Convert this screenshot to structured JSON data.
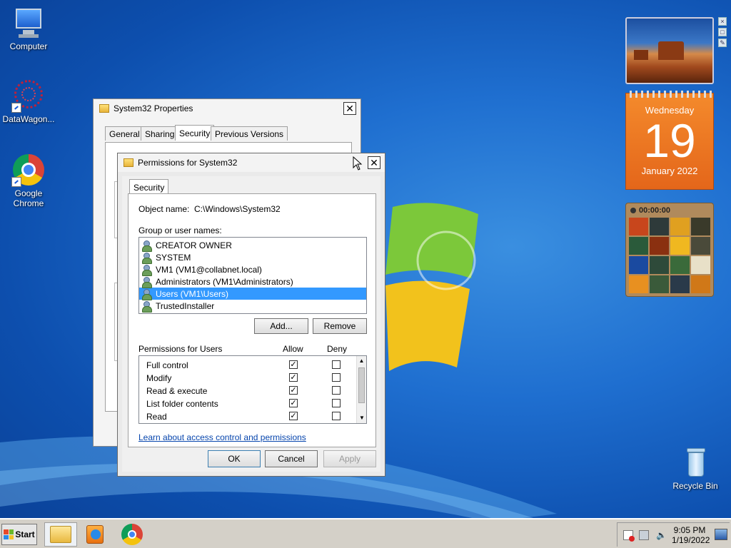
{
  "desktop": {
    "icons": [
      {
        "label": "Computer"
      },
      {
        "label": "DataWagon..."
      },
      {
        "label": "Google Chrome"
      },
      {
        "label": "Recycle Bin"
      }
    ]
  },
  "gadgets": {
    "calendar": {
      "weekday": "Wednesday",
      "day": "19",
      "month_year": "January 2022"
    },
    "puzzle": {
      "timer": "00:00:00"
    }
  },
  "properties_window": {
    "title": "System32 Properties",
    "tabs": [
      "General",
      "Sharing",
      "Security",
      "Previous Versions"
    ],
    "active_tab": "Security"
  },
  "permissions_dialog": {
    "title": "Permissions for System32",
    "tab": "Security",
    "object_name_label": "Object name:",
    "object_name_value": "C:\\Windows\\System32",
    "group_label": "Group or user names:",
    "users": [
      "CREATOR OWNER",
      "SYSTEM",
      "VM1 (VM1@collabnet.local)",
      "Administrators (VM1\\Administrators)",
      "Users (VM1\\Users)",
      "TrustedInstaller"
    ],
    "selected_user_index": 4,
    "add_button": "Add...",
    "remove_button": "Remove",
    "permissions_header": "Permissions for Users",
    "allow_header": "Allow",
    "deny_header": "Deny",
    "permissions": [
      {
        "name": "Full control",
        "allow": true,
        "deny": false
      },
      {
        "name": "Modify",
        "allow": true,
        "deny": false
      },
      {
        "name": "Read & execute",
        "allow": true,
        "deny": false
      },
      {
        "name": "List folder contents",
        "allow": true,
        "deny": false
      },
      {
        "name": "Read",
        "allow": true,
        "deny": false
      }
    ],
    "learn_link": "Learn about access control and permissions",
    "ok_button": "OK",
    "cancel_button": "Cancel",
    "apply_button": "Apply"
  },
  "taskbar": {
    "start_label": "Start",
    "time": "9:05 PM",
    "date": "1/19/2022"
  }
}
